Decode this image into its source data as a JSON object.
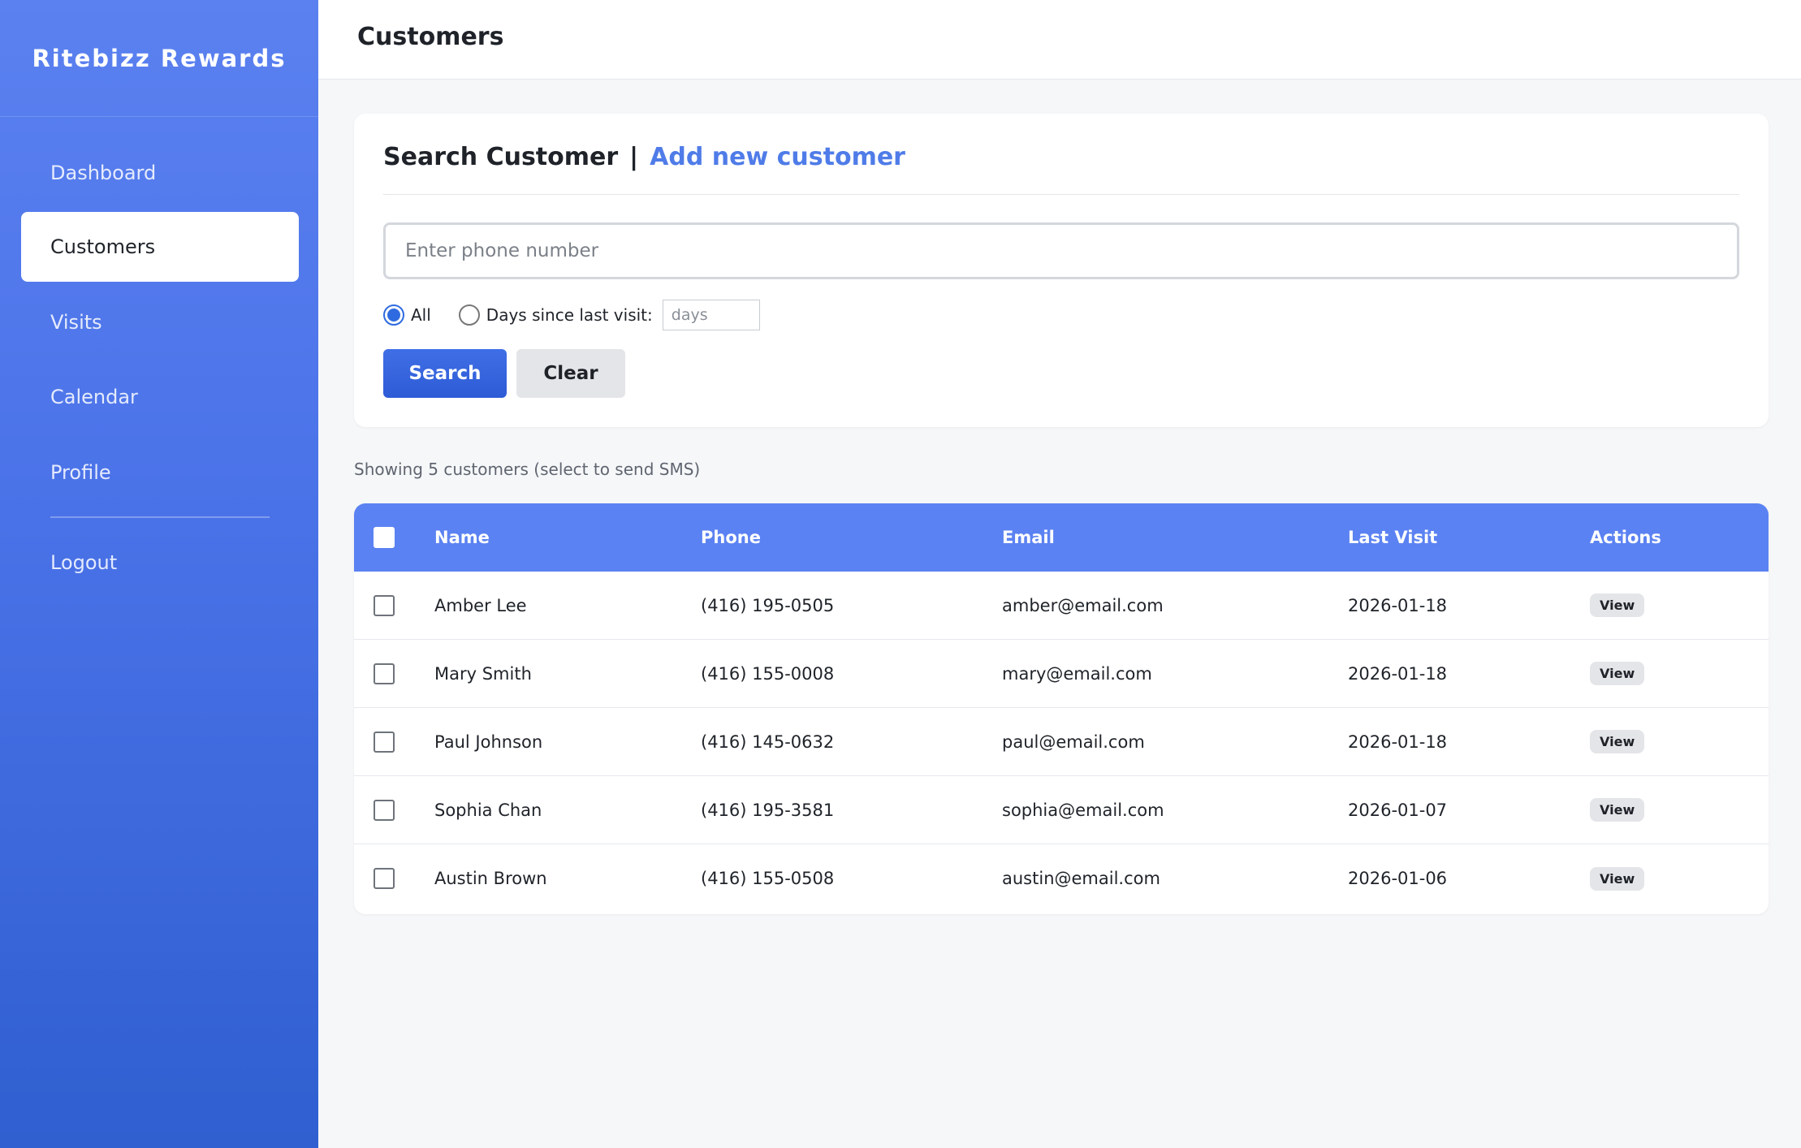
{
  "app": {
    "brand": "Ritebizz Rewards",
    "accent_color": "#5b82f2"
  },
  "sidebar": {
    "items": [
      {
        "label": "Dashboard",
        "active": false
      },
      {
        "label": "Customers",
        "active": true
      },
      {
        "label": "Visits",
        "active": false
      },
      {
        "label": "Calendar",
        "active": false
      },
      {
        "label": "Profile",
        "active": false
      }
    ],
    "logout_label": "Logout"
  },
  "header": {
    "title": "Customers"
  },
  "search_card": {
    "title": "Search Customer",
    "separator": "|",
    "add_link": "Add new customer",
    "phone_placeholder": "Enter phone number",
    "radio_all_label": "All",
    "radio_all_checked": true,
    "radio_days_label": "Days since last visit:",
    "radio_days_checked": false,
    "days_placeholder": "days",
    "search_button": "Search",
    "clear_button": "Clear"
  },
  "results": {
    "summary": "Showing 5 customers (select to send SMS)",
    "columns": [
      "Name",
      "Phone",
      "Email",
      "Last Visit",
      "Actions"
    ],
    "rows": [
      {
        "name": "Amber Lee",
        "phone": "(416) 195-0505",
        "email": "amber@email.com",
        "last_visit": "2026-01-18",
        "action": "View"
      },
      {
        "name": "Mary Smith",
        "phone": "(416) 155-0008",
        "email": "mary@email.com",
        "last_visit": "2026-01-18",
        "action": "View"
      },
      {
        "name": "Paul Johnson",
        "phone": "(416) 145-0632",
        "email": "paul@email.com",
        "last_visit": "2026-01-18",
        "action": "View"
      },
      {
        "name": "Sophia Chan",
        "phone": "(416) 195-3581",
        "email": "sophia@email.com",
        "last_visit": "2026-01-07",
        "action": "View"
      },
      {
        "name": "Austin Brown",
        "phone": "(416) 155-0508",
        "email": "austin@email.com",
        "last_visit": "2026-01-06",
        "action": "View"
      }
    ]
  }
}
